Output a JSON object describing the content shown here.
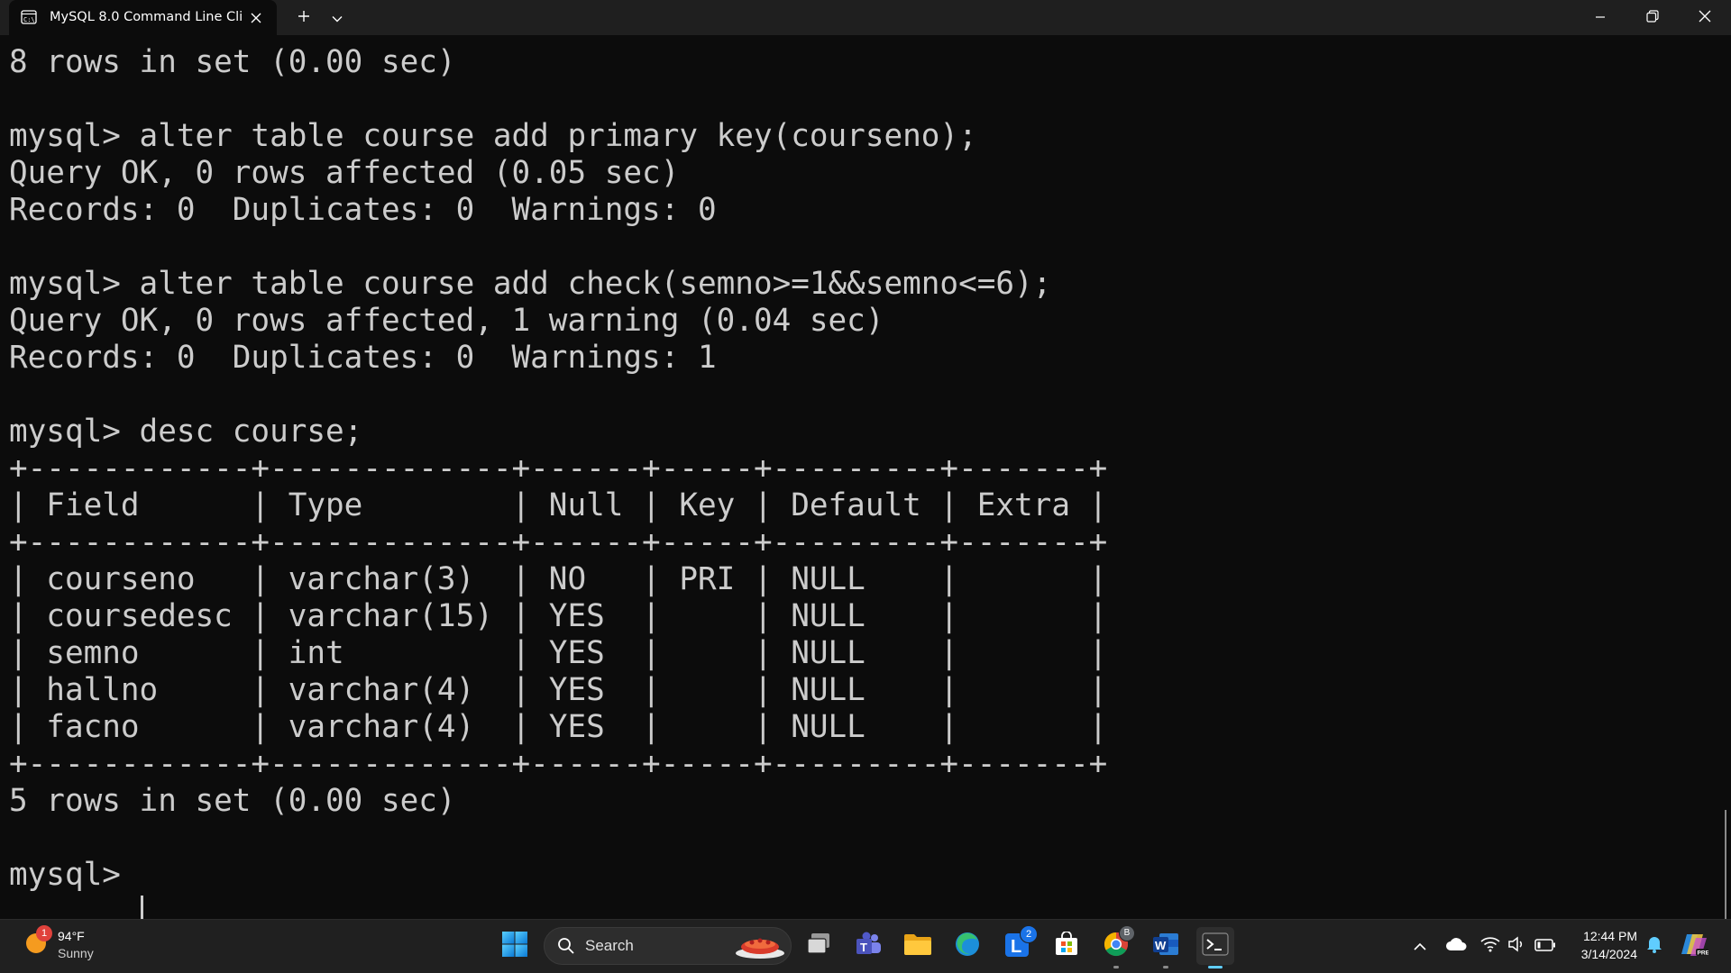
{
  "window": {
    "tab_title": "MySQL 8.0 Command Line Cli",
    "tab_icon": "terminal-icon",
    "new_tab_icon": "plus-icon",
    "dropdown_icon": "chevron-down-icon",
    "minimize_icon": "minimize-icon",
    "maximize_icon": "restore-icon",
    "close_icon": "close-icon"
  },
  "terminal": {
    "lines": [
      "8 rows in set (0.00 sec)",
      "",
      "mysql> alter table course add primary key(courseno);",
      "Query OK, 0 rows affected (0.05 sec)",
      "Records: 0  Duplicates: 0  Warnings: 0",
      "",
      "mysql> alter table course add check(semno>=1&&semno<=6);",
      "Query OK, 0 rows affected, 1 warning (0.04 sec)",
      "Records: 0  Duplicates: 0  Warnings: 1",
      "",
      "mysql> desc course;",
      "+------------+-------------+------+-----+---------+-------+",
      "| Field      | Type        | Null | Key | Default | Extra |",
      "+------------+-------------+------+-----+---------+-------+",
      "| courseno   | varchar(3)  | NO   | PRI | NULL    |       |",
      "| coursedesc | varchar(15) | YES  |     | NULL    |       |",
      "| semno      | int         | YES  |     | NULL    |       |",
      "| hallno     | varchar(4)  | YES  |     | NULL    |       |",
      "| facno      | varchar(4)  | YES  |     | NULL    |       |",
      "+------------+-------------+------+-----+---------+-------+",
      "5 rows in set (0.00 sec)",
      "",
      "mysql> "
    ],
    "text_color": "#cccccc",
    "background": "#0c0c0c"
  },
  "taskbar": {
    "weather": {
      "temp": "94°F",
      "condition": "Sunny",
      "badge": "1",
      "icon": "sun-icon"
    },
    "search_label": "Search",
    "apps": [
      {
        "name": "start",
        "icon": "windows-logo-icon"
      },
      {
        "name": "task-view",
        "icon": "task-view-icon"
      },
      {
        "name": "teams",
        "icon": "teams-icon"
      },
      {
        "name": "file-explorer",
        "icon": "folder-icon"
      },
      {
        "name": "edge",
        "icon": "edge-icon"
      },
      {
        "name": "launcher",
        "icon": "l-app-icon",
        "badge": "2"
      },
      {
        "name": "store",
        "icon": "store-icon"
      },
      {
        "name": "chrome",
        "icon": "chrome-icon",
        "badge": "B"
      },
      {
        "name": "word",
        "icon": "word-icon"
      },
      {
        "name": "terminal",
        "icon": "terminal-icon"
      }
    ],
    "tray": {
      "time": "12:44 PM",
      "date": "3/14/2024"
    }
  },
  "colors": {
    "accent": "#60cdff",
    "titlebar": "#1f1f1f",
    "taskbar": "#202020"
  }
}
